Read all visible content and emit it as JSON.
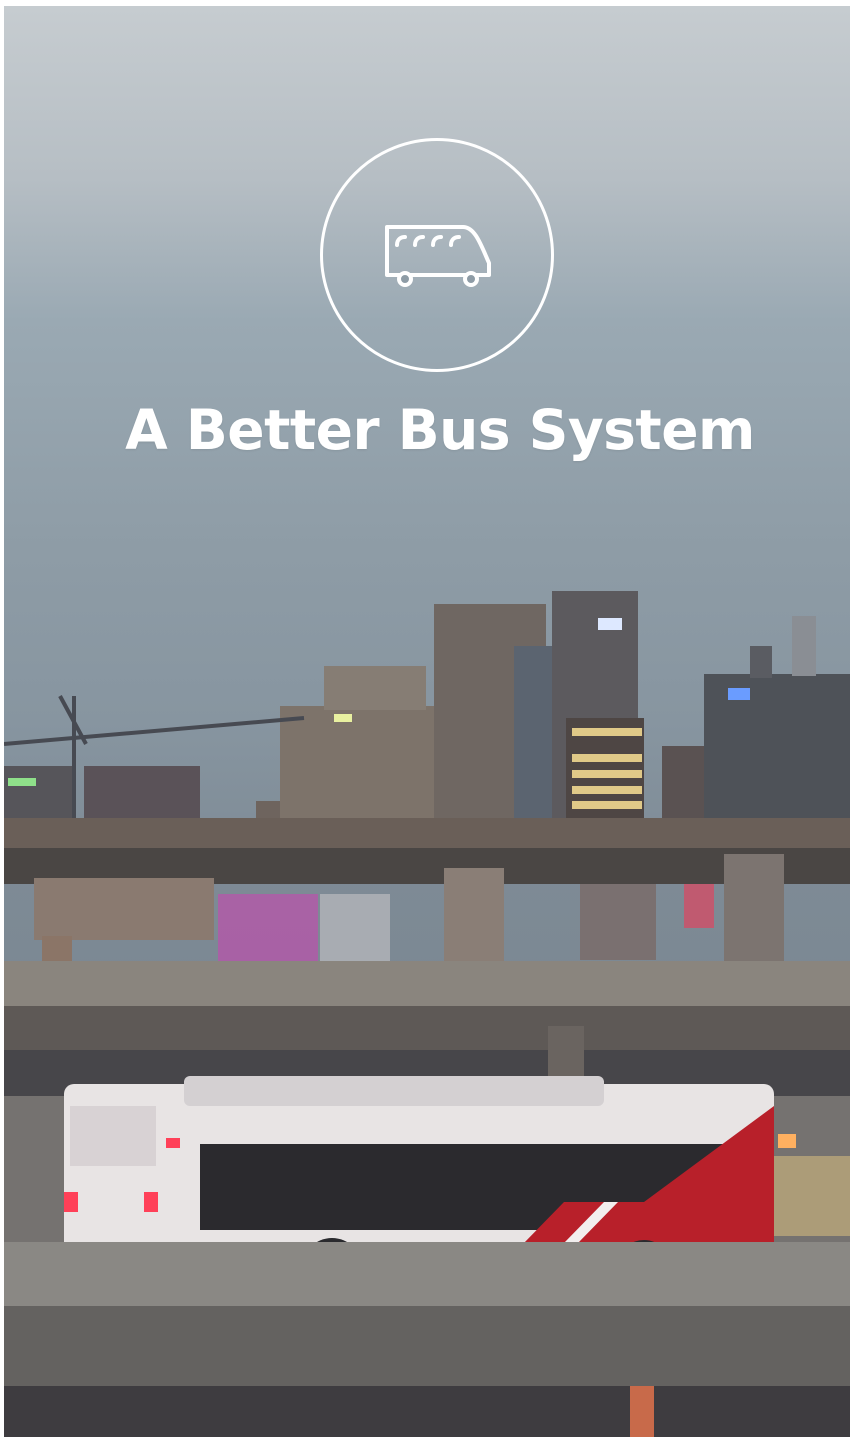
{
  "hero": {
    "icon": "bus-icon",
    "headline": "A Better Bus System"
  },
  "colors": {
    "text": "#ffffff",
    "sky": "#8e9ca6",
    "bus_red": "#b8202a",
    "bus_white": "#e8e4e4"
  }
}
